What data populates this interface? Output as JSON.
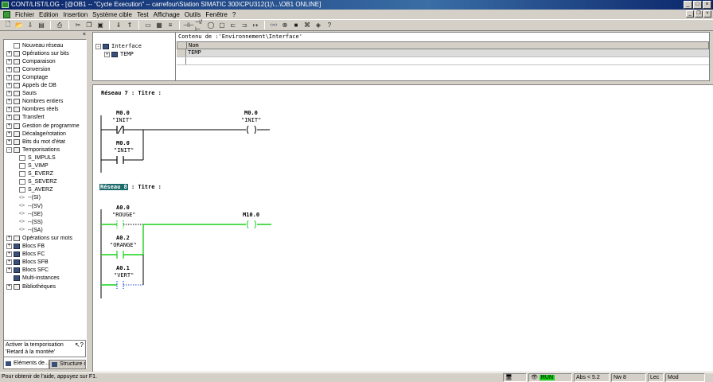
{
  "window": {
    "title": "CONT/LIST/LOG - [@OB1 -- \"Cycle Execution\" -- carrefour\\Station SIMATIC 300\\CPU312(1)\\...\\OB1  ONLINE]"
  },
  "menu": [
    "Fichier",
    "Edition",
    "Insertion",
    "Système cible",
    "Test",
    "Affichage",
    "Outils",
    "Fenêtre",
    "?"
  ],
  "catalog": {
    "items": [
      {
        "label": "Nouveau réseau",
        "level": 0,
        "expander": "",
        "icon": "op"
      },
      {
        "label": "Opérations sur bits",
        "level": 0,
        "expander": "+",
        "icon": "book"
      },
      {
        "label": "Comparaison",
        "level": 0,
        "expander": "+",
        "icon": "book"
      },
      {
        "label": "Conversion",
        "level": 0,
        "expander": "+",
        "icon": "book"
      },
      {
        "label": "Comptage",
        "level": 0,
        "expander": "+",
        "icon": "book"
      },
      {
        "label": "Appels de DB",
        "level": 0,
        "expander": "+",
        "icon": "book"
      },
      {
        "label": "Sauts",
        "level": 0,
        "expander": "+",
        "icon": "book"
      },
      {
        "label": "Nombres entiers",
        "level": 0,
        "expander": "+",
        "icon": "book"
      },
      {
        "label": "Nombres réels",
        "level": 0,
        "expander": "+",
        "icon": "book"
      },
      {
        "label": "Transfert",
        "level": 0,
        "expander": "+",
        "icon": "book"
      },
      {
        "label": "Gestion de programme",
        "level": 0,
        "expander": "+",
        "icon": "book"
      },
      {
        "label": "Décalage/rotation",
        "level": 0,
        "expander": "+",
        "icon": "book"
      },
      {
        "label": "Bits du mot d'état",
        "level": 0,
        "expander": "+",
        "icon": "book"
      },
      {
        "label": "Temporisations",
        "level": 0,
        "expander": "-",
        "icon": "book"
      },
      {
        "label": "S_IMPULS",
        "level": 1,
        "expander": "",
        "icon": "op"
      },
      {
        "label": "S_VIMP",
        "level": 1,
        "expander": "",
        "icon": "op"
      },
      {
        "label": "S_EVERZ",
        "level": 1,
        "expander": "",
        "icon": "op"
      },
      {
        "label": "S_SEVERZ",
        "level": 1,
        "expander": "",
        "icon": "op"
      },
      {
        "label": "S_AVERZ",
        "level": 1,
        "expander": "",
        "icon": "op"
      },
      {
        "label": "--(SI)",
        "level": 1,
        "expander": "",
        "icon": "arrow"
      },
      {
        "label": "--(SV)",
        "level": 1,
        "expander": "",
        "icon": "arrow"
      },
      {
        "label": "--(SE)",
        "level": 1,
        "expander": "",
        "icon": "arrow"
      },
      {
        "label": "--(SS)",
        "level": 1,
        "expander": "",
        "icon": "arrow"
      },
      {
        "label": "--(SA)",
        "level": 1,
        "expander": "",
        "icon": "arrow"
      },
      {
        "label": "Opérations sur mots",
        "level": 0,
        "expander": "+",
        "icon": "book"
      },
      {
        "label": "Blocs FB",
        "level": 0,
        "expander": "+",
        "icon": "blk"
      },
      {
        "label": "Blocs FC",
        "level": 0,
        "expander": "+",
        "icon": "blk"
      },
      {
        "label": "Blocs SFB",
        "level": 0,
        "expander": "+",
        "icon": "blk"
      },
      {
        "label": "Blocs SFC",
        "level": 0,
        "expander": "+",
        "icon": "blk"
      },
      {
        "label": "Multi-instances",
        "level": 0,
        "expander": "",
        "icon": "blk"
      },
      {
        "label": "Bibliothèques",
        "level": 0,
        "expander": "+",
        "icon": "book"
      }
    ],
    "info_line1": "Activer la temporisation",
    "info_line2": "'Retard à la montée'",
    "tabs": [
      "Eléments de...",
      "Structure d"
    ]
  },
  "interface": {
    "tree_root": "Interface",
    "tree_child": "TEMP",
    "content_title": "Contenu de :'Environnement\\Interface'",
    "col_name": "Nom",
    "row1": "TEMP"
  },
  "networks": [
    {
      "header": "Réseau",
      "number": "7",
      "title": ": Titre :",
      "contacts": [
        {
          "addr": "M0.0",
          "sym": "\"INIT\""
        },
        {
          "addr": "M0.0",
          "sym": "\"INIT\""
        }
      ],
      "coil": {
        "addr": "M0.0",
        "sym": "\"INIT\""
      }
    },
    {
      "header": "Réseau",
      "number": "8",
      "title": ": Titre :",
      "contacts": [
        {
          "addr": "A0.0",
          "sym": "\"ROUGE\""
        },
        {
          "addr": "A0.2",
          "sym": "\"ORANGE\""
        },
        {
          "addr": "A0.1",
          "sym": "\"VERT\""
        }
      ],
      "coil": {
        "addr": "M10.0",
        "sym": ""
      }
    }
  ],
  "status": {
    "help": "Pour obtenir de l'aide, appuyez sur F1.",
    "mode": "RUN",
    "position": "Abs < 5.2",
    "nw": "Nw 8",
    "read": "Lec",
    "mod": "Mod"
  },
  "colors": {
    "energized": "#19d019",
    "unpowered": "#000000",
    "selection": "#1c6b6b"
  }
}
